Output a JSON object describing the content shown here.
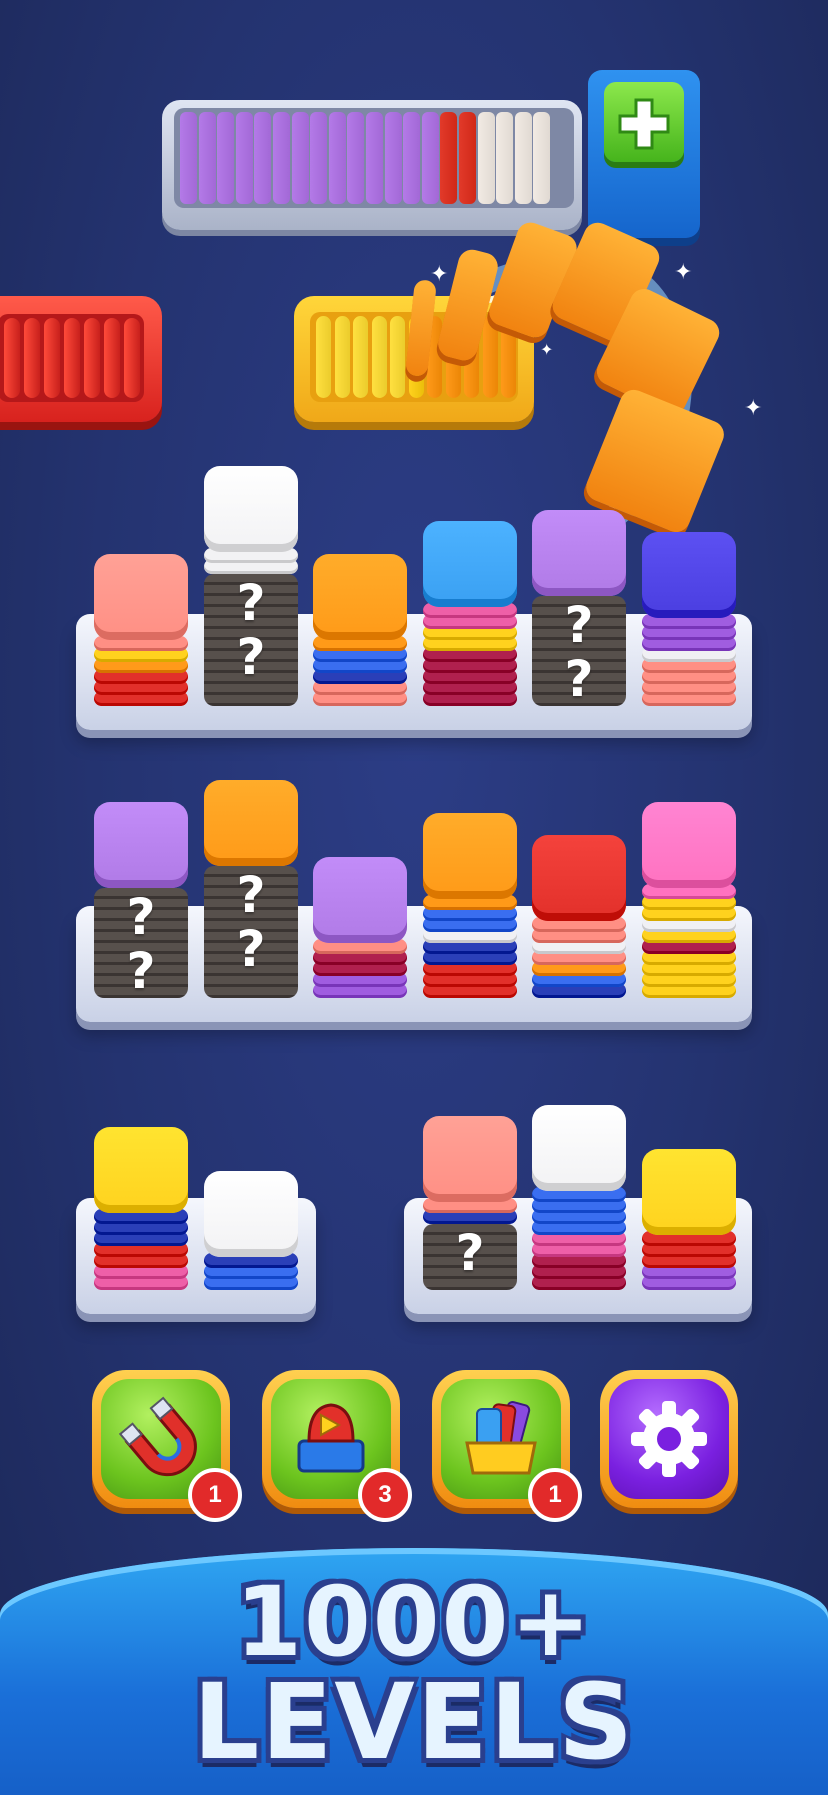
{
  "colors": {
    "background": "#243370",
    "accent_orange": "#f18310",
    "tray_red": "#e53030",
    "tray_yellow": "#ffc81a",
    "purple": "#b07ae6",
    "booster_green": "#6cc41e",
    "settings_purple": "#7a20e0",
    "badge_red": "#e22a2a",
    "footer_blue": "#1a6fd8"
  },
  "top_tray": {
    "slot_colors": [
      "#b47ae8",
      "#b47ae8",
      "#b47ae8",
      "#b47ae8",
      "#b47ae8",
      "#b47ae8",
      "#b47ae8",
      "#b47ae8",
      "#b47ae8",
      "#b47ae8",
      "#b47ae8",
      "#b47ae8",
      "#b47ae8",
      "#b47ae8",
      "#e23a2a",
      "#e23a2a",
      "#f2ebe4",
      "#f2ebe4",
      "#f2ebe4",
      "#f2ebe4"
    ],
    "add_button_icon": "plus-icon"
  },
  "shelves": [
    {
      "stacks": [
        {
          "top": "#ff8f84",
          "layers": [
            "#ff8f84",
            "#ff8f84",
            "#ffd21e",
            "#ff9a1a",
            "#e2302a",
            "#e2302a",
            "#e2302a"
          ],
          "hidden": false
        },
        {
          "top": "#f2f2f4",
          "layers": [
            "#f2f2f4",
            "#f2f2f4",
            "#f2f2f4"
          ],
          "hidden": true,
          "hidden_count": 12
        },
        {
          "top": "#ff9a18",
          "layers": [
            "#ff9a18",
            "#ff9a18",
            "#3a6ef0",
            "#3a6ef0",
            "#2a3fb8",
            "#ff8f84",
            "#ff8f84"
          ],
          "hidden": false
        },
        {
          "top": "#3aa0f2",
          "layers": [
            "#3aa0f2",
            "#ee5fa8",
            "#ee5fa8",
            "#ffd21e",
            "#ffd21e",
            "#b0204e",
            "#b0204e",
            "#b0204e",
            "#b0204e",
            "#b0204e"
          ],
          "hidden": false
        },
        {
          "top": "#b07ae6",
          "layers": [
            "#b07ae6"
          ],
          "hidden": true,
          "hidden_count": 10
        },
        {
          "top": "#4a3ee0",
          "layers": [
            "#4a3ee0",
            "#a05de0",
            "#a05de0",
            "#a05de0",
            "#f0f0f4",
            "#ff8f84",
            "#ff8f84",
            "#ff8f84",
            "#ff8f84"
          ],
          "hidden": false
        }
      ]
    },
    {
      "stacks": [
        {
          "top": "#b07ae6",
          "layers": [
            "#b07ae6"
          ],
          "hidden": true,
          "hidden_count": 10
        },
        {
          "top": "#ff9a18",
          "layers": [
            "#ff9a18"
          ],
          "hidden": true,
          "hidden_count": 12
        },
        {
          "top": "#b07ae6",
          "layers": [
            "#b07ae6",
            "#ff8f84",
            "#b0204e",
            "#b0204e",
            "#a05de0",
            "#a05de0"
          ],
          "hidden": false
        },
        {
          "top": "#ff9a18",
          "layers": [
            "#ff9a18",
            "#ff9a18",
            "#3a6ef0",
            "#3a6ef0",
            "#f0f0f4",
            "#2a3fb8",
            "#2a3fb8",
            "#e2302a",
            "#e2302a",
            "#e2302a"
          ],
          "hidden": false
        },
        {
          "top": "#e2302a",
          "layers": [
            "#e2302a",
            "#ff8f84",
            "#ff8f84",
            "#f0f0f4",
            "#ff8f84",
            "#ff9a1a",
            "#3a6ef0",
            "#2a3fb8"
          ],
          "hidden": false
        },
        {
          "top": "#ff72c0",
          "layers": [
            "#ff72c0",
            "#ff72c0",
            "#ffd21e",
            "#ffd21e",
            "#f0f0f4",
            "#ffd21e",
            "#b0204e",
            "#ffd21e",
            "#ffd21e",
            "#ffd21e",
            "#ffd21e"
          ],
          "hidden": false
        }
      ]
    }
  ],
  "small_shelves": [
    {
      "stacks": [
        {
          "top": "#ffd21e",
          "layers": [
            "#ffd21e",
            "#2a3fb8",
            "#2a3fb8",
            "#2a3fb8",
            "#e2302a",
            "#e2302a",
            "#ee5fa8",
            "#ee5fa8"
          ],
          "hidden": false
        },
        {
          "top": "#f2f2f4",
          "layers": [
            "#f2f2f4",
            "#2a3fb8",
            "#3a6ef0",
            "#3a6ef0"
          ],
          "hidden": false
        }
      ]
    },
    {
      "stacks": [
        {
          "top": "#ff8f84",
          "layers": [
            "#ff8f84",
            "#ff8f84",
            "#2a3fb8"
          ],
          "hidden": true,
          "hidden_count": 6
        },
        {
          "top": "#f2f2f4",
          "layers": [
            "#f2f2f4",
            "#3a6ef0",
            "#3a6ef0",
            "#3a6ef0",
            "#3a6ef0",
            "#ee5fa8",
            "#ee5fa8",
            "#b0204e",
            "#b0204e",
            "#b0204e"
          ],
          "hidden": false
        },
        {
          "top": "#ffd21e",
          "layers": [
            "#ffd21e",
            "#e2302a",
            "#e2302a",
            "#e2302a",
            "#a05de0",
            "#a05de0"
          ],
          "hidden": false
        }
      ]
    }
  ],
  "boosters": [
    {
      "icon": "magnet-icon",
      "count": "1"
    },
    {
      "icon": "shuffle-box-icon",
      "count": "3"
    },
    {
      "icon": "color-box-icon",
      "count": "1"
    },
    {
      "icon": "gear-icon",
      "count": ""
    }
  ],
  "footer": {
    "line1": "1000+",
    "line2": "LEVELS"
  }
}
